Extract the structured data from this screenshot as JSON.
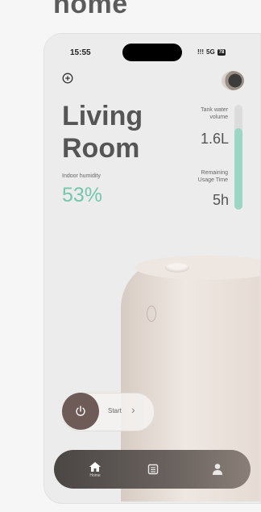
{
  "heading": "home",
  "status": {
    "time": "15:55",
    "signal": "!!!",
    "network": "5G",
    "battery": "78"
  },
  "room": {
    "line1": "Living",
    "line2": "Room"
  },
  "humidity": {
    "label": "Indoor humidity",
    "value": "53%"
  },
  "tank": {
    "label_line1": "Tank water",
    "label_line2": "volume",
    "value": "1.6L",
    "fill_fraction": 0.78
  },
  "remaining": {
    "label_line1": "Remaining",
    "label_line2": "Usage Time",
    "value": "5h"
  },
  "control": {
    "start_label": "Start"
  },
  "nav": {
    "home_label": "Home",
    "items": [
      "home-icon",
      "list-icon",
      "profile-icon"
    ]
  },
  "colors": {
    "accent": "#72c7ad",
    "power": "#6e5a56",
    "nav": "#4a4644"
  }
}
